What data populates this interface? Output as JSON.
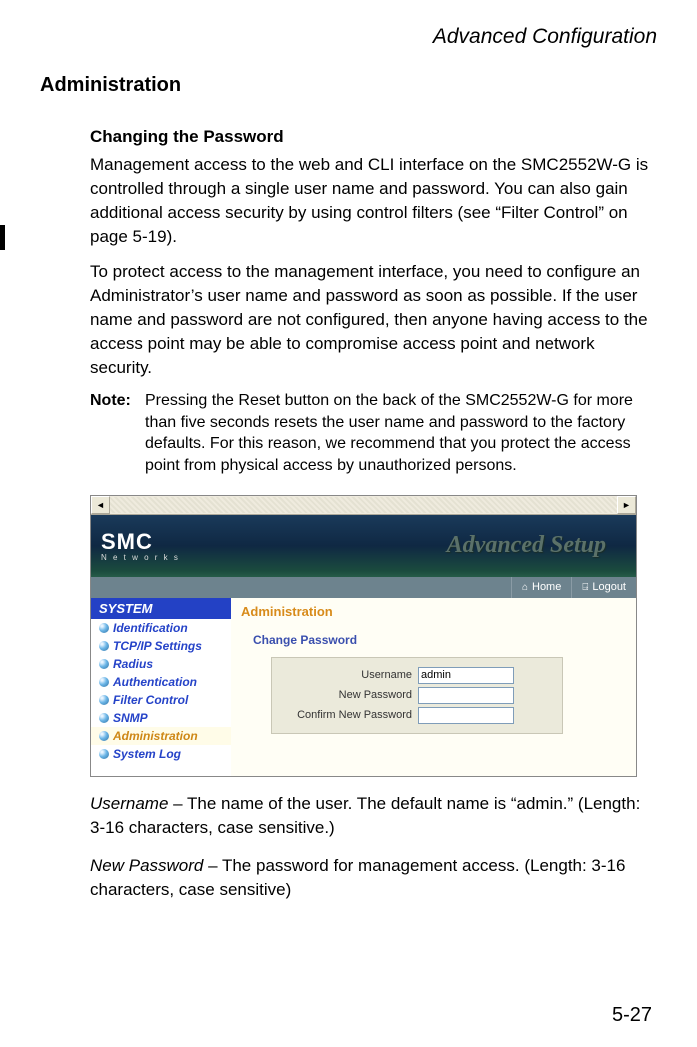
{
  "chapter_title": "Advanced Configuration",
  "section_heading": "Administration",
  "sub_heading": "Changing the Password",
  "para1": "Management access to the web and CLI interface on the SMC2552W-G is controlled through a single user name and password. You can also gain additional access security by using control filters (see “Filter Control” on page 5-19).",
  "para2": "To protect access to the management interface, you need to configure an Administrator’s user name and password as soon as possible. If the user name and password are not configured, then anyone having access to the access point may be able to compromise access point and network security.",
  "note_label": "Note:",
  "note_body": "Pressing the Reset button on the back of the SMC2552W-G for more than five seconds resets the user name and password to the factory defaults. For this reason, we recommend that you protect the access point from physical access by unauthorized persons.",
  "screenshot": {
    "logo_main": "SMC",
    "logo_sub": "N e t w o r k s",
    "banner_title": "Advanced Setup",
    "toolbar": {
      "home": "Home",
      "logout": "Logout"
    },
    "sidebar_header": "SYSTEM",
    "sidebar_items": [
      {
        "label": "Identification",
        "active": false
      },
      {
        "label": "TCP/IP Settings",
        "active": false
      },
      {
        "label": "Radius",
        "active": false
      },
      {
        "label": "Authentication",
        "active": false
      },
      {
        "label": "Filter Control",
        "active": false
      },
      {
        "label": "SNMP",
        "active": false
      },
      {
        "label": "Administration",
        "active": true
      },
      {
        "label": "System Log",
        "active": false
      }
    ],
    "main_title": "Administration",
    "section_label": "Change Password",
    "form": {
      "username_label": "Username",
      "username_value": "admin",
      "newpw_label": "New Password",
      "confirm_label": "Confirm New Password"
    }
  },
  "def_username_term": "Username",
  "def_username_body": " – The name of the user. The default name is “admin.” (Length: 3-16 characters, case sensitive.)",
  "def_newpw_term": "New Password",
  "def_newpw_body": " – The password for management access. (Length: 3-16 characters, case sensitive)",
  "page_number": "5-27"
}
